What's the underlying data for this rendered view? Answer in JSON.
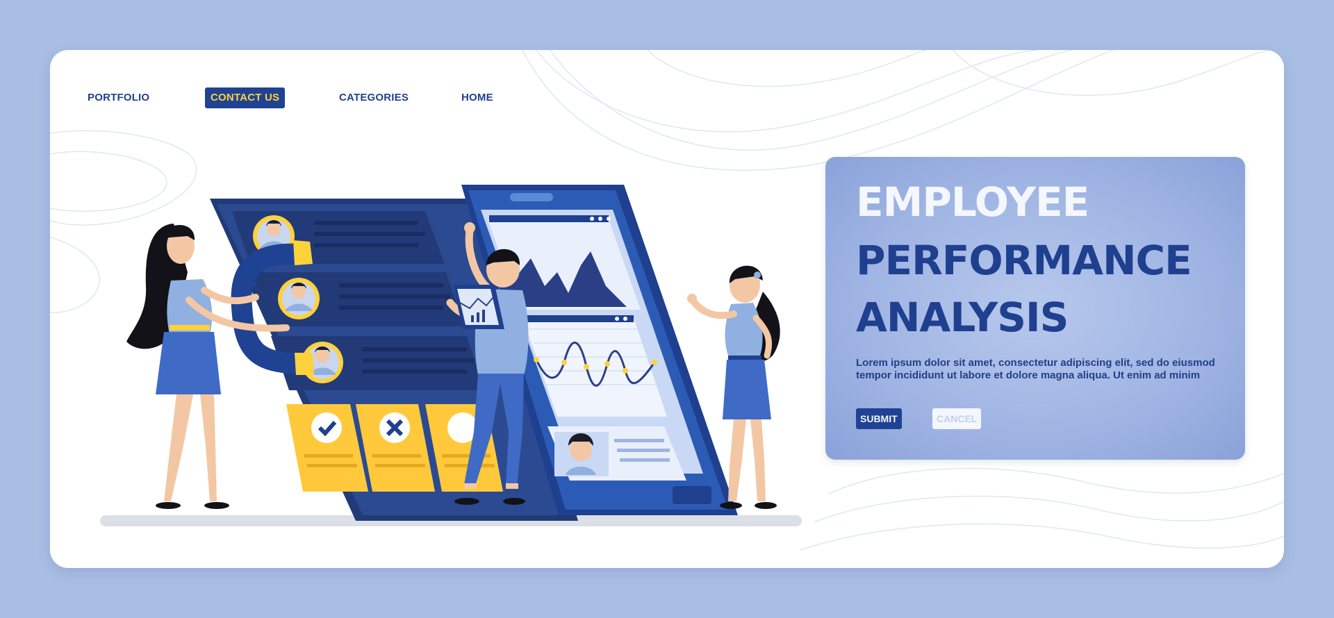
{
  "colors": {
    "background": "#a9bee3",
    "card": "#ffffff",
    "navy": "#1f4293",
    "dark_navy": "#243266",
    "accent_yellow": "#ffd13b",
    "panel": "#9fb4e3",
    "heading_light": "#f4f7ff",
    "heading_dark": "#1f3f8f"
  },
  "nav": {
    "items": [
      {
        "label": "PORTFOLIO",
        "active": false
      },
      {
        "label": "CONTACT US",
        "active": true
      },
      {
        "label": "CATEGORIES",
        "active": false
      },
      {
        "label": "HOME",
        "active": false
      }
    ]
  },
  "hero": {
    "title_line1": "EMPLOYEE",
    "title_line2": "PERFORMANCE",
    "title_line3": "ANALYSIS",
    "body": "Lorem ipsum dolor sit amet, consectetur adipiscing elit, sed do eiusmod tempor incididunt ut labore et dolore magna aliqua. Ut enim ad minim",
    "submit_label": "SUBMIT",
    "cancel_label": "CANCEL"
  },
  "illustration": {
    "icons": [
      "check-icon",
      "cross-icon",
      "magnet-icon",
      "avatar-icon",
      "line-chart-icon",
      "area-chart-icon"
    ]
  }
}
